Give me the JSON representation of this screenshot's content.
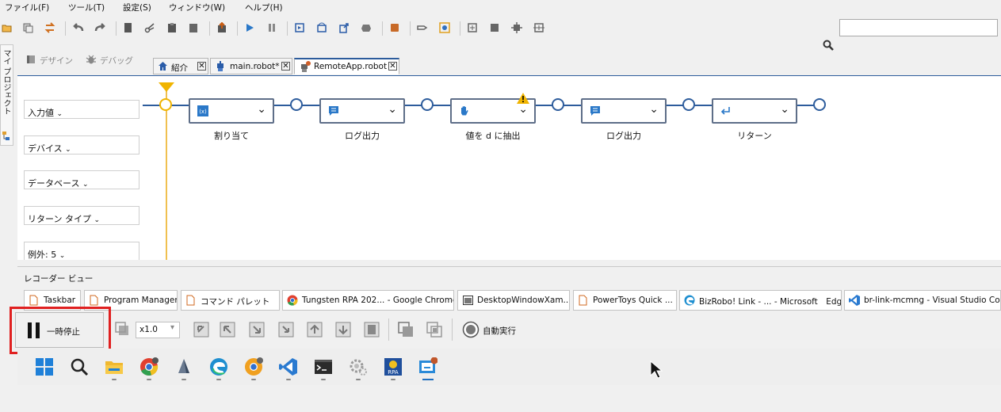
{
  "menu": [
    "ファイル(F)",
    "ツール(T)",
    "設定(S)",
    "ウィンドウ(W)",
    "ヘルプ(H)"
  ],
  "search": {
    "placeholder": ""
  },
  "side_tab": "マイ プロジェクト",
  "view_tabs": {
    "design": "デザイン",
    "debug": "デバッグ"
  },
  "editor_tabs": [
    "紹介",
    "main.robot*",
    "RemoteApp.robot"
  ],
  "left_panel": [
    "入力値",
    "デバイス",
    "データベース",
    "リターン タイプ",
    "例外: 5"
  ],
  "flow_nodes": [
    {
      "label": "割り当て",
      "icon": "variable-icon"
    },
    {
      "label": "ログ出力",
      "icon": "comment-icon"
    },
    {
      "label": "値を d に抽出",
      "icon": "hand-icon",
      "warning": true
    },
    {
      "label": "ログ出力",
      "icon": "comment-icon"
    },
    {
      "label": "リターン",
      "icon": "return-icon"
    }
  ],
  "recorder": {
    "title": "レコーダー ビュー",
    "windows": [
      "Taskbar",
      "Program Manager",
      "コマンド パレット",
      "Tungsten RPA 202... - Google Chrome",
      "DesktopWindowXam...",
      "PowerToys Quick ...",
      "BizRobo! Link - ... - Microsoft　Edge",
      "br-link-mcmng - Visual Studio Co..."
    ],
    "pause_label": "一時停止",
    "speed": "x1.0",
    "auto_run": "自動実行"
  },
  "taskbar_icons": [
    "windows-start-icon",
    "search-icon",
    "file-explorer-icon",
    "chrome-icon",
    "app-icon",
    "edge-icon",
    "chrome-beta-icon",
    "vscode-icon",
    "terminal-icon",
    "settings-icon",
    "rpa-icon",
    "robot-app-icon"
  ],
  "colors": {
    "accent": "#2d5c9c",
    "highlight": "#e02020",
    "warning": "#f0b400",
    "timeline": "#f0c050"
  }
}
